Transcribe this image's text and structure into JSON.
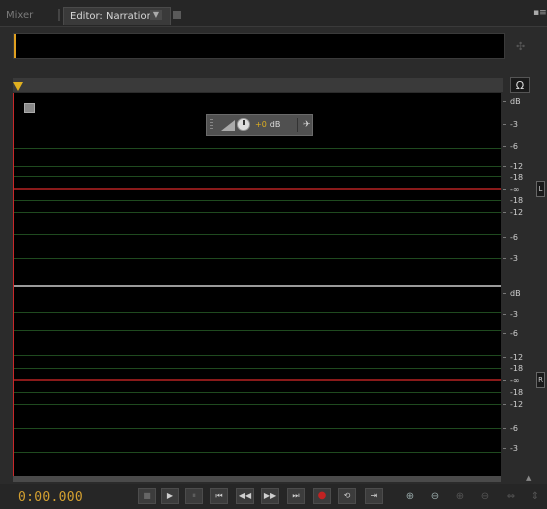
{
  "tabs": {
    "mixer_label": "Mixer",
    "editor_label": "Editor: Narration *",
    "editor_dropdown": "▼",
    "panel_menu": "▪≡"
  },
  "hud": {
    "value": "+0",
    "unit": "dB",
    "pin": "✈"
  },
  "db_scale": {
    "top_channel": [
      "dB",
      "-3",
      "-6",
      "-12",
      "-18",
      "-∞",
      "-18",
      "-12",
      "-6",
      "-3"
    ],
    "bottom_channel": [
      "dB",
      "-3",
      "-6",
      "-12",
      "-18",
      "-∞",
      "-18",
      "-12",
      "-6",
      "-3"
    ]
  },
  "channels": {
    "left_label": "L",
    "right_label": "R"
  },
  "headphones_icon": "Ω",
  "transport": {
    "time": "0:00.000",
    "stop": "■",
    "play": "▶",
    "pause": "⏸",
    "to_start": "⏮",
    "rewind": "◀◀",
    "fast_forward": "▶▶",
    "to_end": "⏭",
    "record": "●",
    "loop": "⟲",
    "skip": "⇥"
  },
  "zoom": {
    "zoom_in_amp": "⊕",
    "zoom_out_amp": "⊖",
    "zoom_in_time": "⊕",
    "zoom_out_time": "⊖",
    "zoom_full": "⇔",
    "zoom_sel": "⇕"
  },
  "colors": {
    "time": "#d4a030",
    "playhead": "#c8282a",
    "cursor": "#e0b020",
    "grid": "#1f4a1f"
  }
}
